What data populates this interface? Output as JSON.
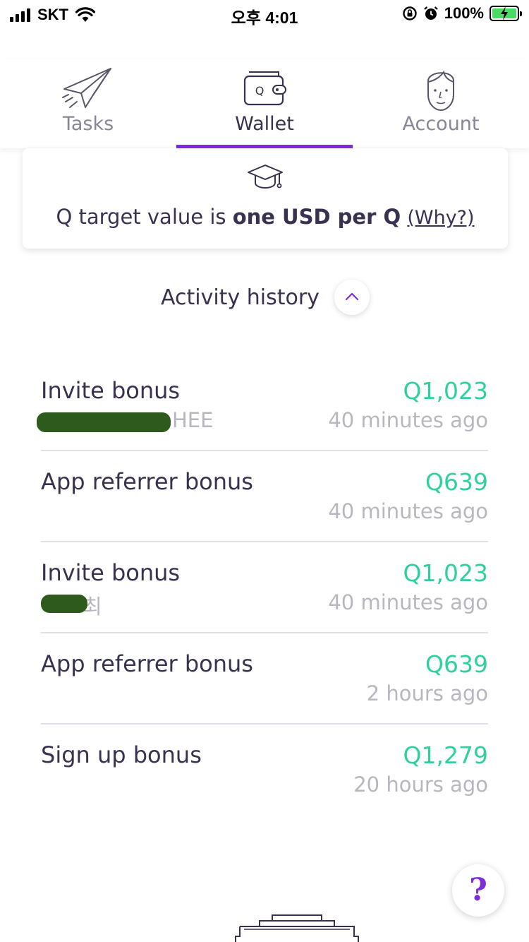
{
  "status_bar": {
    "carrier": "SKT",
    "time": "오후 4:01",
    "battery": "100%"
  },
  "tabs": [
    {
      "label": "Tasks",
      "icon": "paper-plane-icon",
      "active": false
    },
    {
      "label": "Wallet",
      "icon": "wallet-icon",
      "active": true
    },
    {
      "label": "Account",
      "icon": "person-face-icon",
      "active": false
    }
  ],
  "info_card": {
    "icon": "graduation-cap-icon",
    "text_prefix": "Q target value is ",
    "text_bold": "one USD per Q",
    "why_link": "(Why?)"
  },
  "activity": {
    "title": "Activity history",
    "items": [
      {
        "title": "Invite bonus",
        "subtitle": "HEE",
        "amount": "Q1,023",
        "time": "40 minutes ago"
      },
      {
        "title": "App referrer bonus",
        "subtitle": "",
        "amount": "Q639",
        "time": "40 minutes ago"
      },
      {
        "title": "Invite bonus",
        "subtitle": "최",
        "amount": "Q1,023",
        "time": "40 minutes ago"
      },
      {
        "title": "App referrer bonus",
        "subtitle": "",
        "amount": "Q639",
        "time": "2 hours ago"
      },
      {
        "title": "Sign up bonus",
        "subtitle": "",
        "amount": "Q1,279",
        "time": "20 hours ago"
      }
    ]
  },
  "help_button": {
    "label": "?"
  },
  "colors": {
    "accent": "#7b2fd8",
    "amount": "#2fcf9e",
    "text": "#3a3150",
    "muted": "#b9b6bf"
  }
}
